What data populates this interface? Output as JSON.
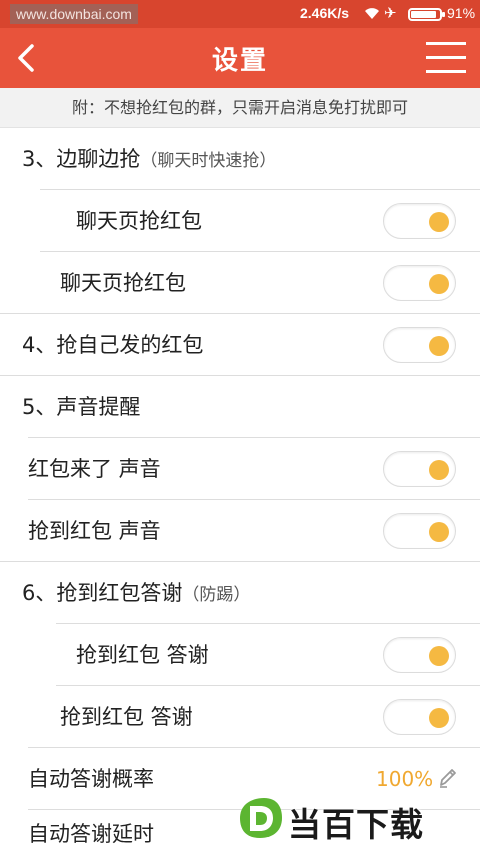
{
  "status_bar": {
    "watermark": "www.downbai.com",
    "network_speed": "2.46K/s",
    "battery_level": 0.91,
    "battery_text": "91%",
    "icons": [
      "wifi-icon",
      "airplane-icon",
      "battery-icon"
    ]
  },
  "header": {
    "title": "设置",
    "back_icon": "chevron-left-icon",
    "menu_icon": "hamburger-menu-icon",
    "color": "#e8533b"
  },
  "notice": "附：不想抢红包的群，只需开启消息免打扰即可",
  "sections": {
    "s3": {
      "title": "3、边聊边抢",
      "sub": "（聊天时快速抢）"
    },
    "s4": {
      "title": "4、抢自己发的红包",
      "toggle_on": true
    },
    "s5": {
      "title": "5、声音提醒"
    },
    "s6": {
      "title": "6、抢到红包答谢",
      "sub": "（防踢）"
    }
  },
  "rows": {
    "chat_grab_1": {
      "label": "聊天页抢红包",
      "toggle_on": true
    },
    "chat_grab_2": {
      "label": "聊天页抢红包",
      "toggle_on": true
    },
    "sound_incoming": {
      "label": "红包来了 声音",
      "toggle_on": true
    },
    "sound_grabbed": {
      "label": "抢到红包 声音",
      "toggle_on": true
    },
    "thanks_1": {
      "label": "抢到红包 答谢",
      "toggle_on": true
    },
    "thanks_2": {
      "label": "抢到红包 答谢",
      "toggle_on": true
    },
    "auto_thanks_rate": {
      "label": "自动答谢概率",
      "value": "100%",
      "edit_icon": "pencil-icon"
    },
    "auto_thanks_delay": {
      "label": "自动答谢延时"
    }
  },
  "brand": {
    "text": "当百下载",
    "logo_letter": "D"
  },
  "colors": {
    "accent": "#e8533b",
    "toggle_knob": "#f5b942",
    "value_text": "#f0a830"
  }
}
